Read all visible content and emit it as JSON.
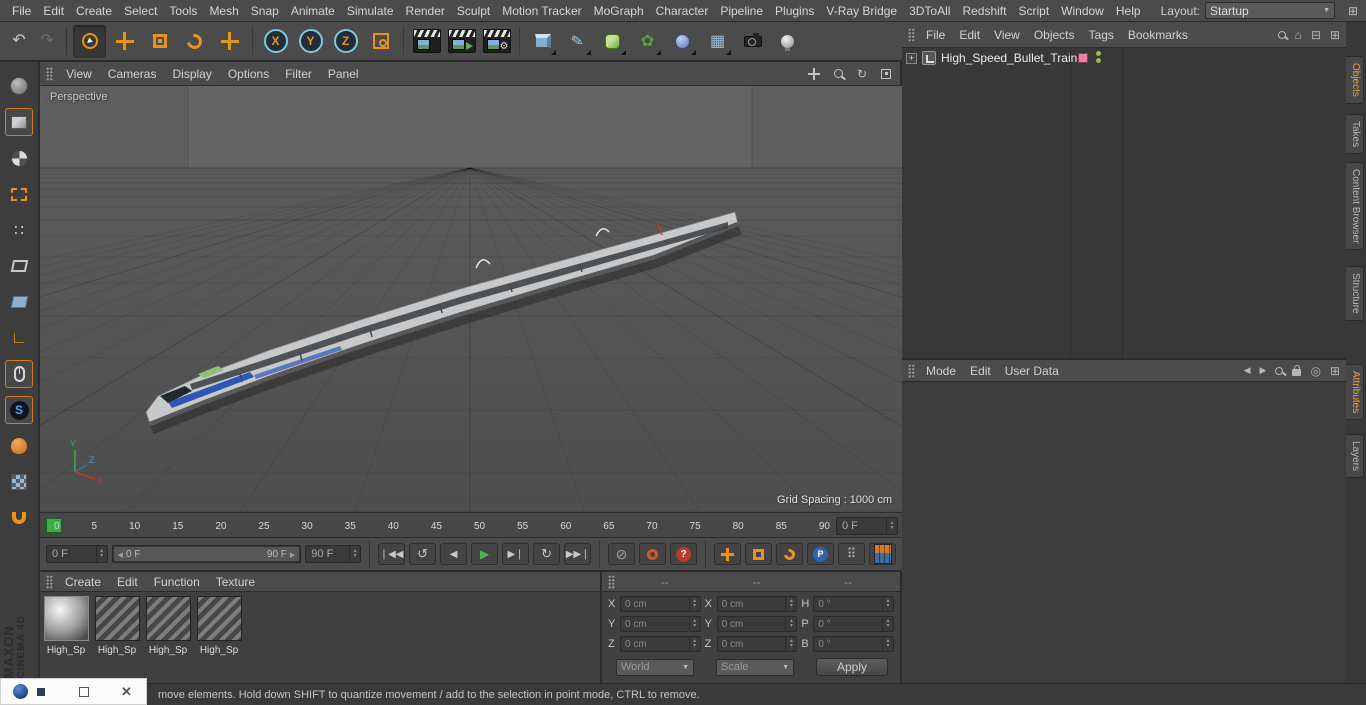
{
  "menubar": {
    "items": [
      "File",
      "Edit",
      "Create",
      "Select",
      "Tools",
      "Mesh",
      "Snap",
      "Animate",
      "Simulate",
      "Render",
      "Sculpt",
      "Motion Tracker",
      "MoGraph",
      "Character",
      "Pipeline",
      "Plugins",
      "V-Ray Bridge",
      "3DToAll",
      "Redshift",
      "Script",
      "Window",
      "Help"
    ],
    "layout_label": "Layout:",
    "layout_value": "Startup"
  },
  "toolbar": {
    "axis_x": "X",
    "axis_y": "Y",
    "axis_z": "Z"
  },
  "left_toolbar": {
    "snap_label": "S"
  },
  "viewport": {
    "menu": [
      "View",
      "Cameras",
      "Display",
      "Options",
      "Filter",
      "Panel"
    ],
    "camera_label": "Perspective",
    "grid_spacing": "Grid Spacing : 1000 cm",
    "axis_labels": {
      "x": "X",
      "y": "Y",
      "z": "Z"
    }
  },
  "timeline": {
    "ticks": [
      "0",
      "5",
      "10",
      "15",
      "20",
      "25",
      "30",
      "35",
      "40",
      "45",
      "50",
      "55",
      "60",
      "65",
      "70",
      "75",
      "80",
      "85",
      "90"
    ],
    "frame_field": "0 F"
  },
  "animbar": {
    "current_frame": "0 F",
    "range_start": "0 F",
    "range_end": "90 F",
    "end_frame": "90 F",
    "record_param_label": "P"
  },
  "materials": {
    "menu": [
      "Create",
      "Edit",
      "Function",
      "Texture"
    ],
    "items": [
      "High_Sp",
      "High_Sp",
      "High_Sp",
      "High_Sp"
    ]
  },
  "coordinates": {
    "headers": [
      "--",
      "--",
      "--"
    ],
    "position": [
      {
        "label": "X",
        "value": "0 cm"
      },
      {
        "label": "Y",
        "value": "0 cm"
      },
      {
        "label": "Z",
        "value": "0 cm"
      }
    ],
    "size": [
      {
        "label": "X",
        "value": "0 cm"
      },
      {
        "label": "Y",
        "value": "0 cm"
      },
      {
        "label": "Z",
        "value": "0 cm"
      }
    ],
    "rotation": [
      {
        "label": "H",
        "value": "0 °"
      },
      {
        "label": "P",
        "value": "0 °"
      },
      {
        "label": "B",
        "value": "0 °"
      }
    ],
    "space": "World",
    "mode": "Scale",
    "apply": "Apply"
  },
  "objects": {
    "menu": [
      "File",
      "Edit",
      "View",
      "Objects",
      "Tags",
      "Bookmarks"
    ],
    "tree": [
      {
        "label": "High_Speed_Bullet_Train"
      }
    ]
  },
  "attributes": {
    "menu": [
      "Mode",
      "Edit",
      "User Data"
    ]
  },
  "side_tabs": [
    "Objects",
    "Takes",
    "Content Browser",
    "Structure",
    "Attributes",
    "Layers"
  ],
  "statusbar": {
    "text": "move elements. Hold down SHIFT to quantize movement / add to the selection in point mode, CTRL to remove."
  },
  "branding": {
    "line1": "MAXON",
    "line2": "CINEMA 4D"
  },
  "colors": {
    "accent_orange": "#e8941a",
    "play_green": "#4fb54a",
    "record_red": "#c0392b"
  }
}
